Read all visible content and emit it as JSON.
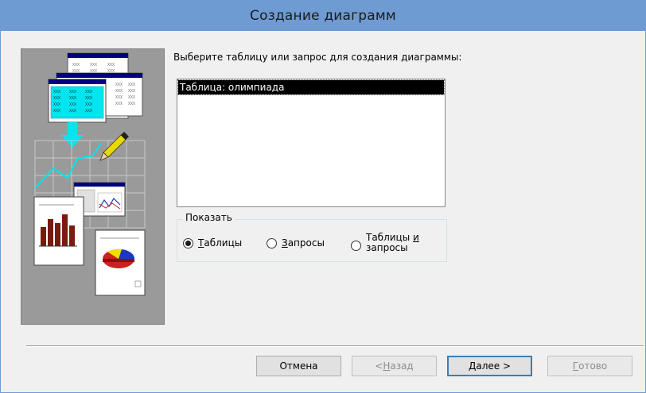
{
  "window": {
    "title": "Создание диаграмм"
  },
  "prompt": "Выберите таблицу или запрос для создания диаграммы:",
  "list": {
    "items": [
      "Таблица: олимпиада"
    ],
    "selected_index": 0
  },
  "show_group": {
    "legend": "Показать",
    "options": [
      {
        "pre": "",
        "ul": "Т",
        "post": "аблицы",
        "checked": true
      },
      {
        "pre": "",
        "ul": "З",
        "post": "апросы",
        "checked": false
      },
      {
        "line1_pre": "Таблицы ",
        "line1_ul": "и",
        "line2": "запросы",
        "checked": false
      }
    ]
  },
  "buttons": {
    "cancel": "Отмена",
    "back_prefix": "< ",
    "back_ul": "Н",
    "back_rest": "азад",
    "next_ul": "Д",
    "next_rest": "алее >",
    "finish_ul": "Г",
    "finish_rest": "отово"
  },
  "illustration": {
    "sheet_cell_text": "XXX"
  },
  "colors": {
    "titlebar": "#6f9bd3",
    "accent_cyan": "#00e5ee",
    "selection": "#000000"
  }
}
